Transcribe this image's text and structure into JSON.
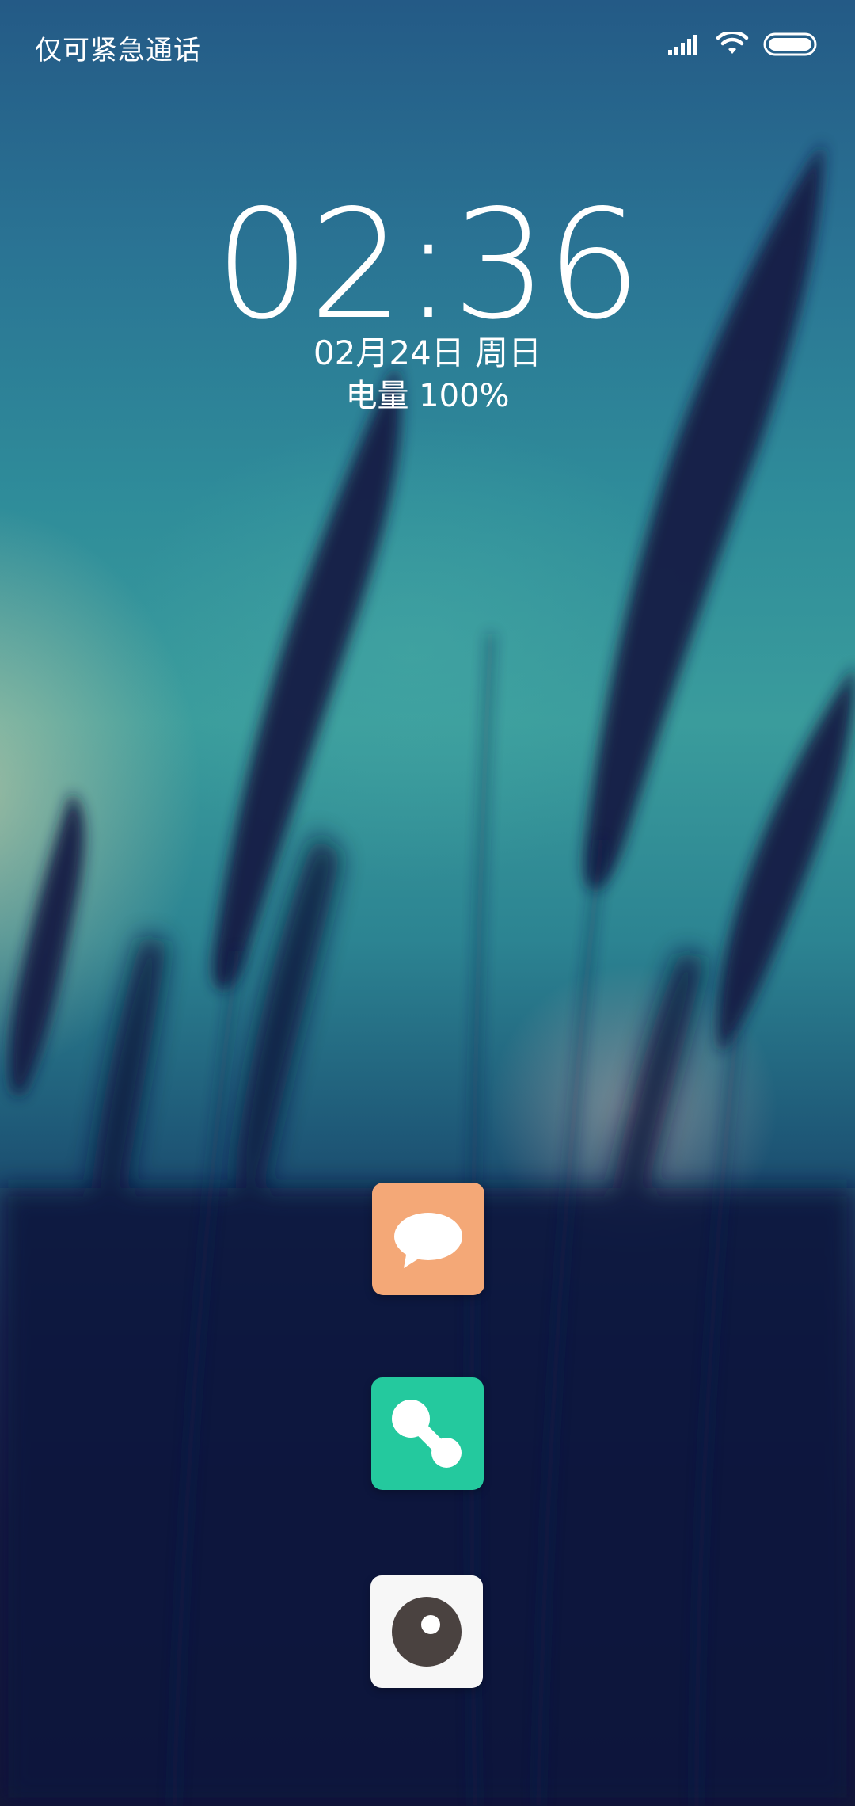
{
  "status_bar": {
    "carrier_text": "仅可紧急通话",
    "icons": [
      "signal-icon",
      "wifi-icon",
      "battery-icon"
    ]
  },
  "lock_screen": {
    "time": "02:36",
    "date": "02月24日 周日",
    "battery": "电量 100%"
  },
  "shortcuts": [
    {
      "name": "messages",
      "icon": "chat-bubble-icon",
      "color": "#f4a877"
    },
    {
      "name": "remote",
      "icon": "dumbbell-link-icon",
      "color": "#24c99e"
    },
    {
      "name": "camera",
      "icon": "camera-lens-icon",
      "color": "#f7f7f7"
    }
  ]
}
